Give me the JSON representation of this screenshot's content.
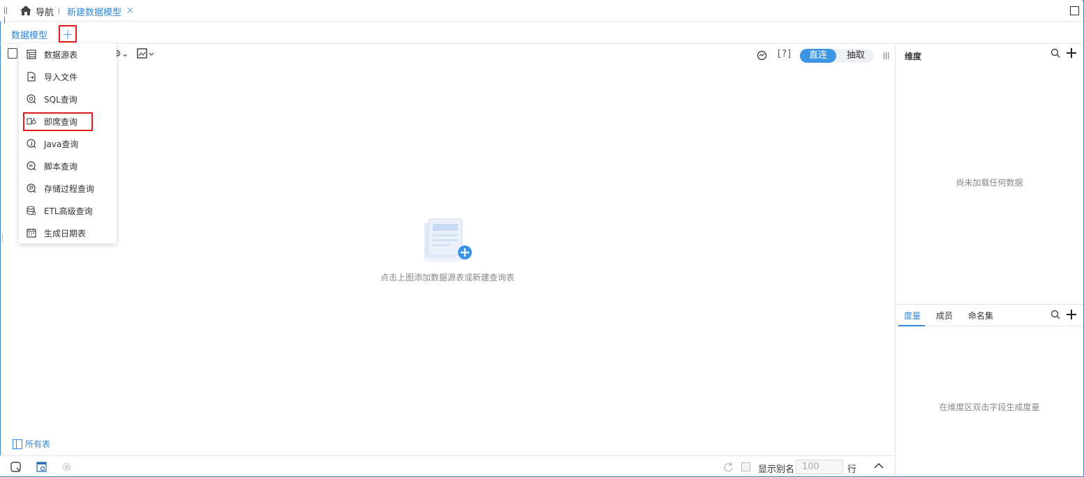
{
  "topbar": {
    "nav_label": "导航",
    "active_tab": "新建数据模型",
    "close_glyph": "×"
  },
  "subbar": {
    "model_tab": "数据模型",
    "add_glyph": "+"
  },
  "toolbar": {
    "help_label": "[?]",
    "mode_direct": "直连",
    "mode_extract": "抽取"
  },
  "add_menu": {
    "items": [
      {
        "label": "数据源表",
        "icon": "table-icon"
      },
      {
        "label": "导入文件",
        "icon": "import-file-icon"
      },
      {
        "label": "SQL查询",
        "icon": "sql-query-icon"
      },
      {
        "label": "即席查询",
        "icon": "adhoc-query-icon",
        "highlighted": true
      },
      {
        "label": "Java查询",
        "icon": "java-query-icon"
      },
      {
        "label": "脚本查询",
        "icon": "script-query-icon"
      },
      {
        "label": "存储过程查询",
        "icon": "stored-procedure-icon"
      },
      {
        "label": "ETL高级查询",
        "icon": "etl-query-icon"
      },
      {
        "label": "生成日期表",
        "icon": "calendar-icon"
      }
    ]
  },
  "canvas": {
    "empty_hint": "点击上图添加数据源表或新建查询表",
    "all_tables_label": "所有表"
  },
  "statusbar": {
    "show_alias_label": "显示别名",
    "rows_value": "100",
    "rows_unit": "行"
  },
  "right_panel": {
    "dimension_title": "维度",
    "dimension_empty": "尚未加载任何数据",
    "tabs": [
      "度量",
      "成员",
      "命名集"
    ],
    "measure_empty": "在维度区双击字段生成度量"
  },
  "colors": {
    "accent": "#2f88d9",
    "highlight_border": "#e31b1b",
    "toggle_on": "#3b95e4"
  }
}
